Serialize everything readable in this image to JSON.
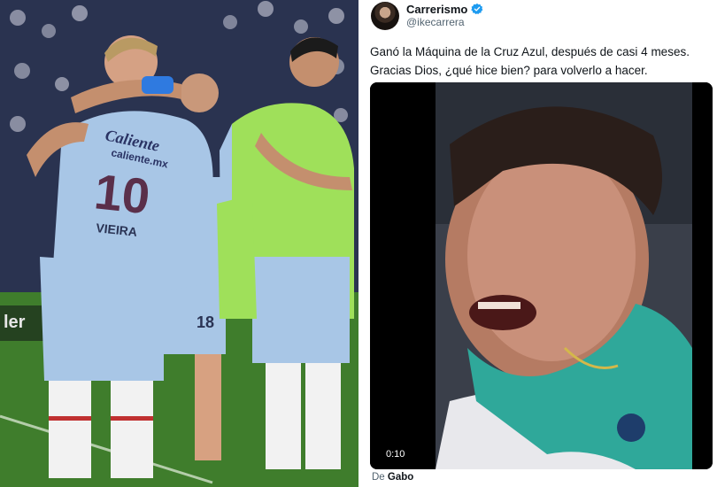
{
  "photo": {
    "jersey_sponsor": "Caliente",
    "jersey_sponsor_url": "caliente.mx",
    "jersey_number": "10",
    "jersey_name": "VIEIRA",
    "shorts_number": "18"
  },
  "tweet": {
    "display_name": "Carrerismo",
    "handle": "@ikecarrera",
    "text_line_1": "Ganó la Máquina de la Cruz Azul, después de casi 4 meses.",
    "text_line_2": "Gracias Dios, ¿qué hice bien? para volverlo a hacer.",
    "video_time": "0:10",
    "source_prefix": "De",
    "source_name": "Gabo"
  },
  "icons": {
    "verified": "verified-badge-icon",
    "avatar": "avatar"
  },
  "colors": {
    "verified_blue": "#1d9bf0",
    "jersey_blue": "#a8c6e6",
    "bib_green": "#9fe05a",
    "text_dark": "#0f1419",
    "text_muted": "#536471",
    "fan_shirt_teal": "#2fa89a"
  }
}
